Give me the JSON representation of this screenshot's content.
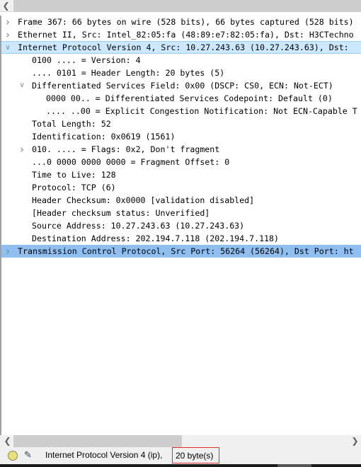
{
  "tree": [
    {
      "level": 0,
      "toggle": "collapsed",
      "text": "Frame 367: 66 bytes on wire (528 bits), 66 bytes captured (528 bits)"
    },
    {
      "level": 0,
      "toggle": "collapsed",
      "text": "Ethernet II, Src: Intel_82:05:fa (48:89:e7:82:05:fa), Dst: H3CTechno"
    },
    {
      "level": 0,
      "toggle": "expanded",
      "selected": "light",
      "text": "Internet Protocol Version 4, Src: 10.27.243.63 (10.27.243.63), Dst: "
    },
    {
      "level": 1,
      "text": "0100 .... = Version: 4"
    },
    {
      "level": 1,
      "text": ".... 0101 = Header Length: 20 bytes (5)"
    },
    {
      "level": 1,
      "toggle": "expanded",
      "text": "Differentiated Services Field: 0x00 (DSCP: CS0, ECN: Not-ECT)"
    },
    {
      "level": 2,
      "text": "0000 00.. = Differentiated Services Codepoint: Default (0)"
    },
    {
      "level": 2,
      "text": ".... ..00 = Explicit Congestion Notification: Not ECN-Capable T"
    },
    {
      "level": 1,
      "text": "Total Length: 52"
    },
    {
      "level": 1,
      "text": "Identification: 0x0619 (1561)"
    },
    {
      "level": 1,
      "toggle": "collapsed",
      "text": "010. .... = Flags: 0x2, Don't fragment"
    },
    {
      "level": 1,
      "text": "...0 0000 0000 0000 = Fragment Offset: 0"
    },
    {
      "level": 1,
      "text": "Time to Live: 128"
    },
    {
      "level": 1,
      "text": "Protocol: TCP (6)"
    },
    {
      "level": 1,
      "text": "Header Checksum: 0x0000 [validation disabled]"
    },
    {
      "level": 1,
      "text": "[Header checksum status: Unverified]"
    },
    {
      "level": 1,
      "text": "Source Address: 10.27.243.63 (10.27.243.63)"
    },
    {
      "level": 1,
      "text": "Destination Address: 202.194.7.118 (202.194.7.118)"
    },
    {
      "level": 0,
      "toggle": "collapsed",
      "selected": "strong",
      "text": "Transmission Control Protocol, Src Port: 56264 (56264), Dst Port: ht"
    }
  ],
  "status": {
    "field": "Internet Protocol Version 4 (ip),",
    "bytes": "20 byte(s)"
  },
  "icons": {
    "collapsed": "chevron-right-icon",
    "expanded": "chevron-down-icon",
    "scroll_left": "arrow-left-icon",
    "scroll_right": "arrow-right-icon"
  }
}
